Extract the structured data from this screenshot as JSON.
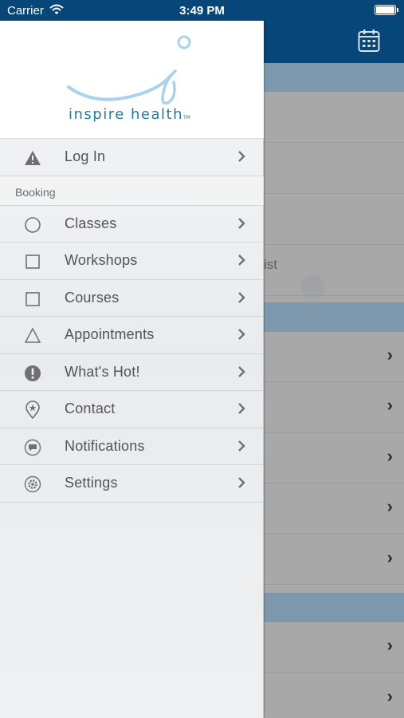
{
  "status_bar": {
    "carrier": "Carrier",
    "time": "3:49 PM",
    "wifi_icon": "wifi-icon",
    "battery_icon": "battery-icon"
  },
  "background": {
    "calendar_icon": "calendar-icon",
    "partial_text": "ist",
    "chevron": "›"
  },
  "logo": {
    "text": "inspire health",
    "tm": "TM"
  },
  "menu": {
    "login": {
      "label": "Log In",
      "icon": "warning-icon"
    },
    "section_header": "Booking",
    "items": [
      {
        "label": "Classes",
        "icon": "circle-icon"
      },
      {
        "label": "Workshops",
        "icon": "square-icon"
      },
      {
        "label": "Courses",
        "icon": "square-icon"
      },
      {
        "label": "Appointments",
        "icon": "triangle-icon"
      },
      {
        "label": "What's Hot!",
        "icon": "exclamation-icon"
      },
      {
        "label": "Contact",
        "icon": "location-pin-icon"
      },
      {
        "label": "Notifications",
        "icon": "chat-bubble-icon"
      },
      {
        "label": "Settings",
        "icon": "gear-icon"
      }
    ]
  },
  "colors": {
    "navbar": "#064679",
    "section": "#7d98ad",
    "logo": "#2a7a9e",
    "logo_swoosh": "#a9d2eb",
    "menu_text": "#535353",
    "icon": "#707070"
  }
}
